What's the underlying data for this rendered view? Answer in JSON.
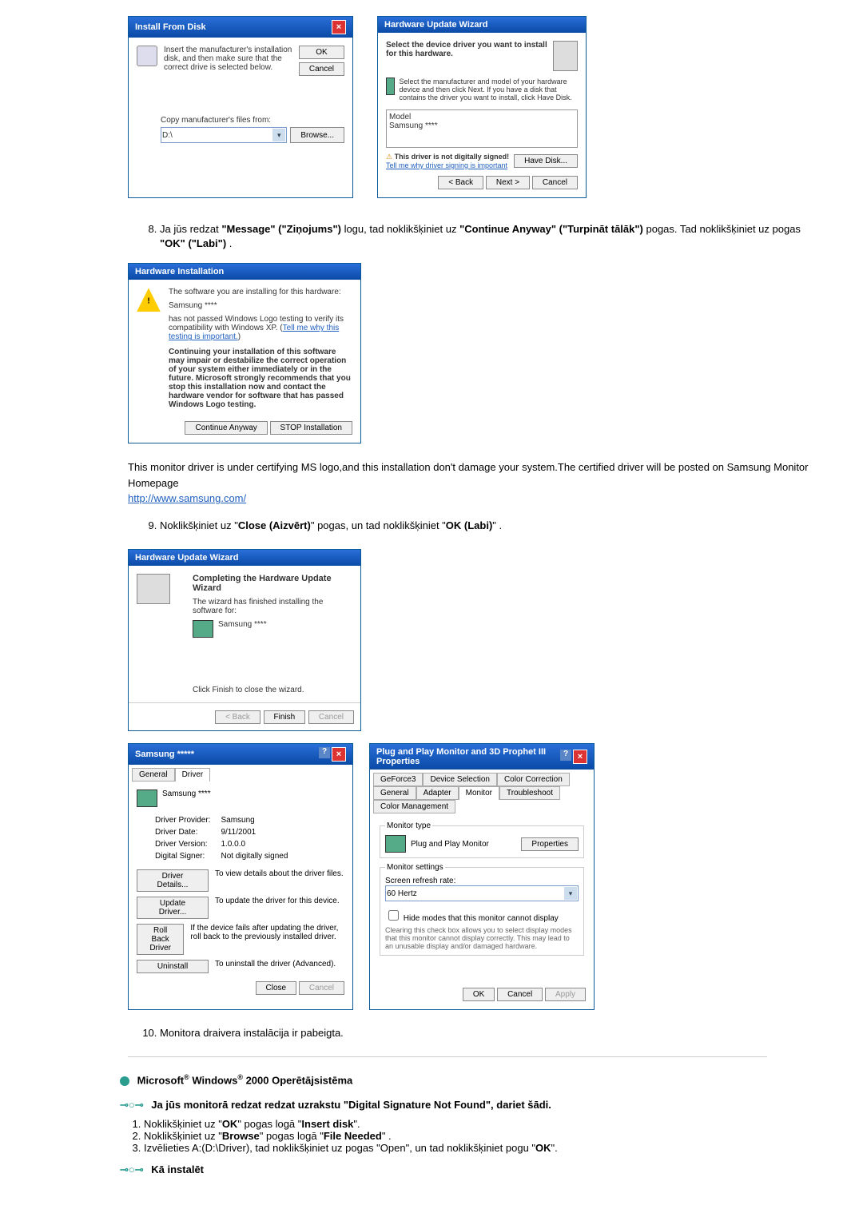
{
  "installDisk": {
    "title": "Install From Disk",
    "instruction": "Insert the manufacturer's installation disk, and then make sure that the correct drive is selected below.",
    "ok": "OK",
    "cancel": "Cancel",
    "copyLabel": "Copy manufacturer's files from:",
    "pathValue": "D:\\",
    "browse": "Browse..."
  },
  "hwWizard": {
    "title": "Hardware Update Wizard",
    "subtitle": "Select the device driver you want to install for this hardware.",
    "tip": "Select the manufacturer and model of your hardware device and then click Next. If you have a disk that contains the driver you want to install, click Have Disk.",
    "modelLabel": "Model",
    "modelValue": "Samsung ****",
    "notSigned": "This driver is not digitally signed!",
    "signingLink": "Tell me why driver signing is important",
    "haveDisk": "Have Disk...",
    "back": "< Back",
    "next": "Next >",
    "cancel": "Cancel"
  },
  "step8": "Ja jūs redzat \"Message\" (\"Ziņojums\") logu, tad noklikšķiniet uz \"Continue Anyway\" (\"Turpināt tālāk\") pogas. Tad noklikšķiniet uz pogas \"OK\" (\"Labi\") .",
  "hwInstall": {
    "title": "Hardware Installation",
    "line1": "The software you are installing for this hardware:",
    "device": "Samsung ****",
    "line2": "has not passed Windows Logo testing to verify its compatibility with Windows XP. (",
    "link": "Tell me why this testing is important.",
    "warn": "Continuing your installation of this software may impair or destabilize the correct operation of your system either immediately or in the future. Microsoft strongly recommends that you stop this installation now and contact the hardware vendor for software that has passed Windows Logo testing.",
    "cont": "Continue Anyway",
    "stop": "STOP Installation"
  },
  "note": "This monitor driver is under certifying MS logo,and this installation don't damage your system.The certified driver will be posted on Samsung Monitor Homepage",
  "noteLink": "http://www.samsung.com/",
  "step9": "Noklikšķiniet uz \"Close (Aizvērt)\" pogas, un tad noklikšķiniet \"OK (Labi)\" .",
  "complete": {
    "title": "Hardware Update Wizard",
    "heading": "Completing the Hardware Update Wizard",
    "line1": "The wizard has finished installing the software for:",
    "device": "Samsung ****",
    "line2": "Click Finish to close the wizard.",
    "back": "< Back",
    "finish": "Finish",
    "cancel": "Cancel"
  },
  "samsungProps": {
    "title": "Samsung *****",
    "tabGeneral": "General",
    "tabDriver": "Driver",
    "device": "Samsung ****",
    "providerLabel": "Driver Provider:",
    "providerValue": "Samsung",
    "dateLabel": "Driver Date:",
    "dateValue": "9/11/2001",
    "versionLabel": "Driver Version:",
    "versionValue": "1.0.0.0",
    "signerLabel": "Digital Signer:",
    "signerValue": "Not digitally signed",
    "details": "Driver Details...",
    "detailsDesc": "To view details about the driver files.",
    "update": "Update Driver...",
    "updateDesc": "To update the driver for this device.",
    "rollback": "Roll Back Driver",
    "rollbackDesc": "If the device fails after updating the driver, roll back to the previously installed driver.",
    "uninstall": "Uninstall",
    "uninstallDesc": "To uninstall the driver (Advanced).",
    "close": "Close",
    "cancel": "Cancel"
  },
  "pnpProps": {
    "title": "Plug and Play Monitor and 3D Prophet III Properties",
    "tabGeForce": "GeForce3",
    "tabDevSel": "Device Selection",
    "tabColorCorr": "Color Correction",
    "tabGeneral": "General",
    "tabAdapter": "Adapter",
    "tabMonitor": "Monitor",
    "tabTrouble": "Troubleshoot",
    "tabColorMgmt": "Color Management",
    "monitorType": "Monitor type",
    "monitorName": "Plug and Play Monitor",
    "properties": "Properties",
    "settings": "Monitor settings",
    "refreshLabel": "Screen refresh rate:",
    "refreshValue": "60 Hertz",
    "hideModes": "Hide modes that this monitor cannot display",
    "hideDesc": "Clearing this check box allows you to select display modes that this monitor cannot display correctly. This may lead to an unusable display and/or damaged hardware.",
    "ok": "OK",
    "cancel": "Cancel",
    "apply": "Apply"
  },
  "step10": "Monitora draivera instalācija ir pabeigta.",
  "win2000": {
    "heading": "Microsoft® Windows® 2000 Operētājsistēma",
    "sub1": "Ja jūs monitorā redzat redzat uzrakstu \"Digital Signature Not Found\", dariet šādi.",
    "item1": "Noklikšķiniet uz \"OK\" pogas logā \"Insert disk\".",
    "item2": "Noklikšķiniet uz \"Browse\" pogas logā \"File Needed\" .",
    "item3": "Izvēlieties A:(D:\\Driver), tad noklikšķiniet uz pogas \"Open\", un tad noklikšķiniet pogu \"OK\".",
    "sub2": "Kā instalēt"
  }
}
